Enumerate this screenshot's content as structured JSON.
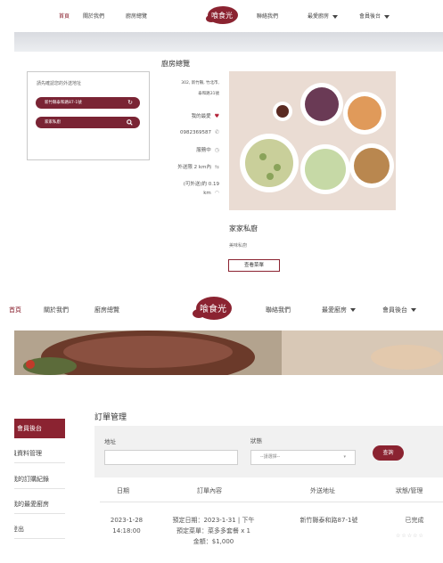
{
  "screen1": {
    "nav": {
      "home": "首頁",
      "about": "關於我們",
      "kitchens": "廚房總覽",
      "contact": "聯絡我們",
      "favorites": "最愛廚房",
      "member": "會員後台"
    },
    "logo_text": "喰食光",
    "address_prompt": "請先確認您的外送地址",
    "address_value": "新竹縣泰和路87-1號",
    "search_value": "家家私廚",
    "kitchen": {
      "section_title": "廚房總覽",
      "address_line1": "302, 新竹縣, 竹北市,",
      "address_line2": "泰和路31號",
      "favorite_label": "我的最愛",
      "phone": "0982369587",
      "status": "服務中",
      "range": "外送限 2 km內",
      "distance_line1": "(可外送)約 0.19",
      "distance_line2": "km",
      "name": "家家私廚",
      "desc": "美味私廚",
      "view_menu": "查看菜單"
    }
  },
  "screen2": {
    "nav": {
      "home": "首頁",
      "about": "關於我們",
      "kitchens": "廚房總覽",
      "contact": "聯絡我們",
      "favorites": "最愛廚房",
      "member": "會員後台"
    },
    "logo_text": "喰食光",
    "sidebar": [
      "會員後台",
      "會員資料管理",
      "我的訂購紀錄",
      "我的最愛廚房",
      "登出"
    ],
    "orders": {
      "title": "訂單管理",
      "address_label": "地址",
      "status_label": "狀態",
      "select_placeholder": "--請選擇--",
      "search_button": "查詢",
      "columns": [
        "日期",
        "訂單內容",
        "外送地址",
        "狀態/管理"
      ],
      "row": {
        "date_line1": "2023-1-28",
        "date_line2": "14:18:00",
        "content_line1": "預定日期：2023-1-31 | 下午",
        "content_line2": "預定菜單：菜多多套餐 x 1",
        "content_line3": "金額：$1,000",
        "address": "新竹縣泰和路87-1號",
        "status": "已完成",
        "rating_stars": "☆☆☆☆☆"
      }
    }
  },
  "colors": {
    "brand": "#8b2331"
  }
}
